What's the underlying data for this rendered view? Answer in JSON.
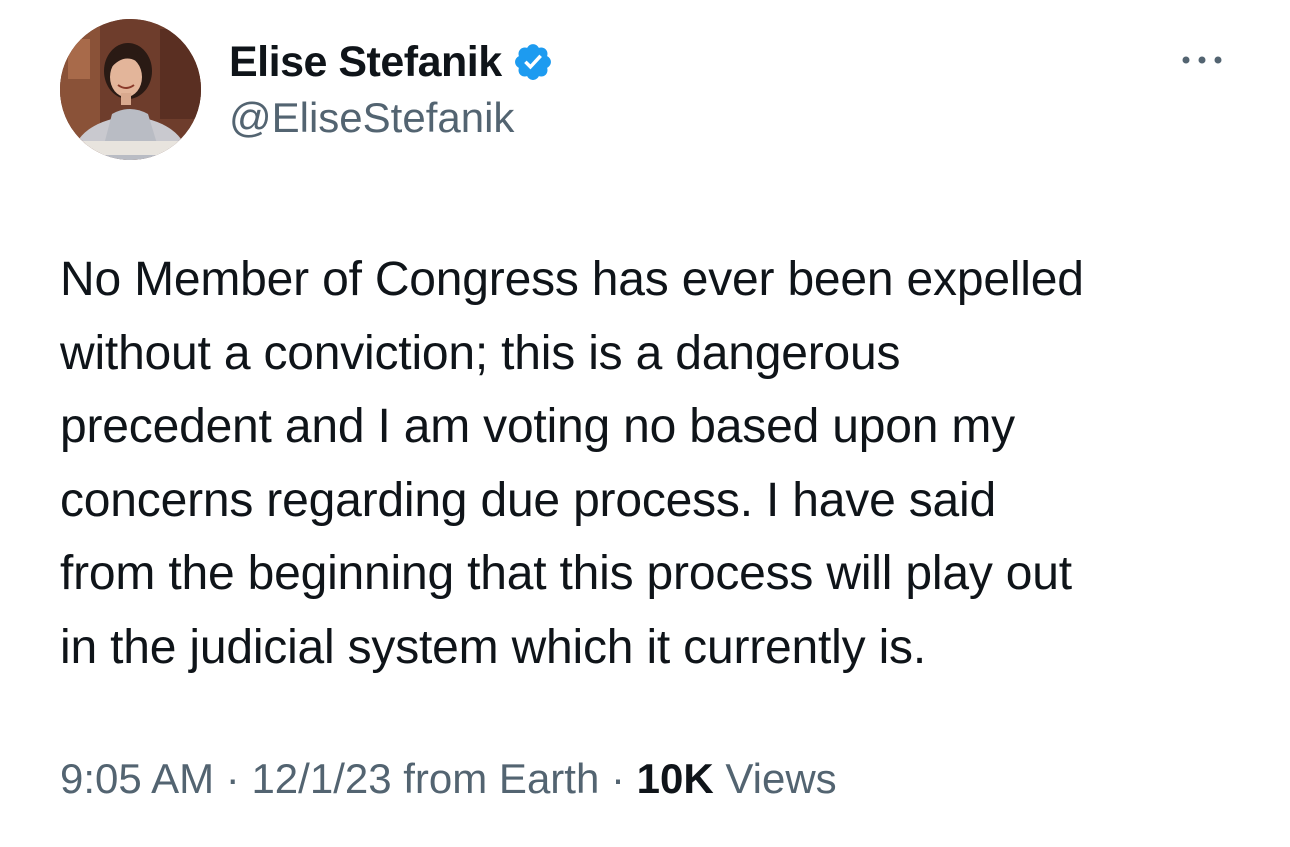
{
  "author": {
    "display_name": "Elise Stefanik",
    "handle": "@EliseStefanik",
    "verified": true,
    "verified_color": "#1d9bf0"
  },
  "tweet": {
    "lines": [
      "No Member of Congress has ever been expelled",
      "without a conviction; this is a dangerous",
      "precedent and I am voting no based upon my",
      "concerns regarding due process. I have said",
      "from the beginning that this process will play out",
      "in the judicial system which it currently is."
    ]
  },
  "meta": {
    "time": "9:05 AM",
    "separator": "·",
    "date": "12/1/23",
    "source": "from Earth",
    "views_count": "10K",
    "views_label": "Views"
  },
  "icons": {
    "more": "more-horizontal-icon",
    "verified": "verified-badge-icon"
  },
  "colors": {
    "text_primary": "#0f1419",
    "text_secondary": "#536471",
    "background": "#ffffff"
  }
}
